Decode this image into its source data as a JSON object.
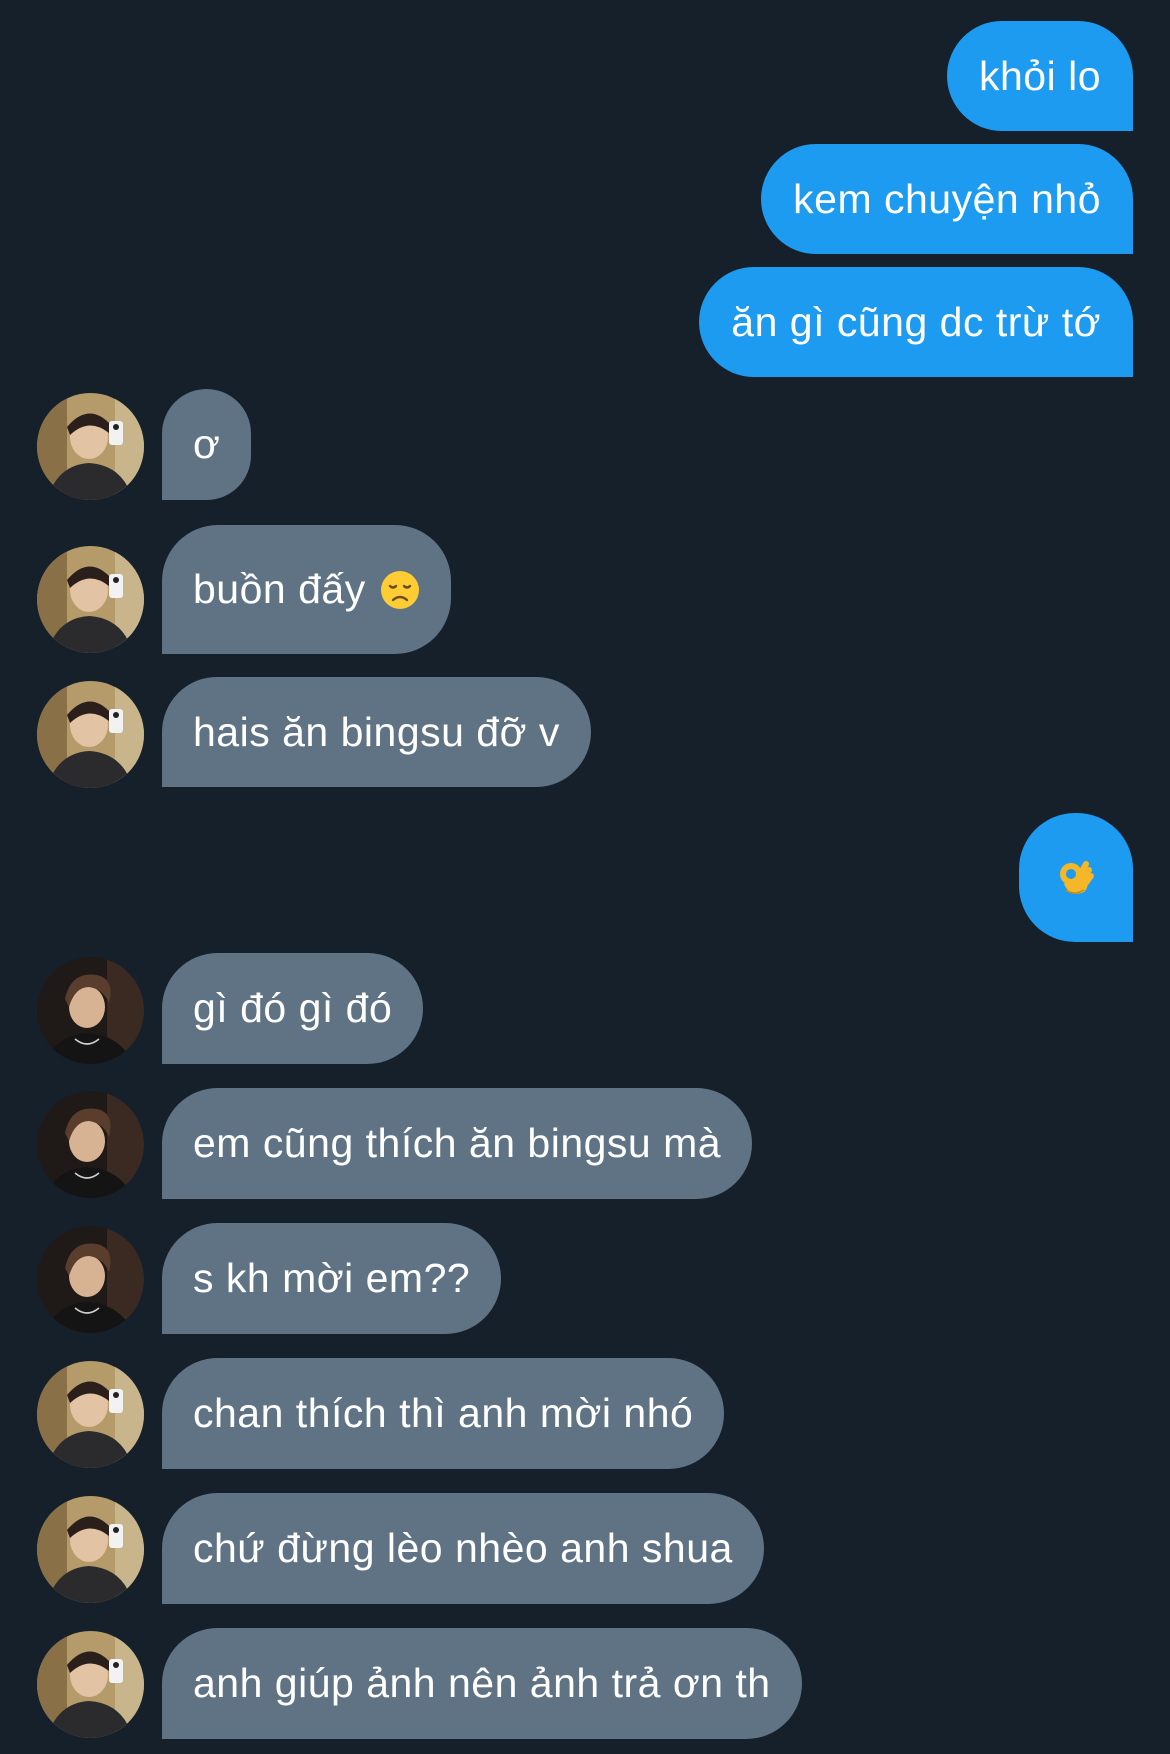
{
  "conversation": {
    "messages": [
      {
        "sender": "me",
        "text": "khỏi lo"
      },
      {
        "sender": "me",
        "text": "kem chuyện nhỏ"
      },
      {
        "sender": "me",
        "text": "ăn gì cũng dc trừ tớ"
      },
      {
        "sender": "friend_a",
        "text": "ơ"
      },
      {
        "sender": "friend_a",
        "text": "buồn đấy",
        "emoji": "disappointed-face-icon"
      },
      {
        "sender": "friend_a",
        "text": "hais ăn bingsu đỡ v"
      },
      {
        "sender": "me",
        "text": "",
        "emoji": "ok-hand-icon"
      },
      {
        "sender": "friend_b",
        "text": "gì đó gì đó"
      },
      {
        "sender": "friend_b",
        "text": "em cũng thích ăn bingsu mà"
      },
      {
        "sender": "friend_b",
        "text": "s kh mời em??"
      },
      {
        "sender": "friend_a",
        "text": "chan thích thì anh mời nhó"
      },
      {
        "sender": "friend_a",
        "text": "chứ đừng lèo nhèo anh shua"
      },
      {
        "sender": "friend_a",
        "text": "anh giúp ảnh nên ảnh trả ơn th"
      }
    ]
  },
  "colors": {
    "background": "#15202b",
    "outgoing_bubble": "#1d9bf0",
    "incoming_bubble": "#5f7384",
    "text": "#ffffff"
  }
}
